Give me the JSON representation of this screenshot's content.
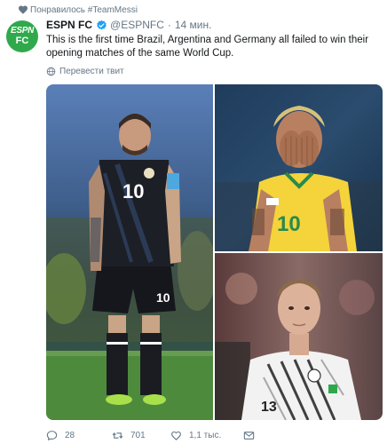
{
  "context": {
    "text": "Понравилось #TeamMessi"
  },
  "author": {
    "name": "ESPN FC",
    "handle": "@ESPNFC",
    "time": "14 мин.",
    "avatar_line1": "ESPN",
    "avatar_line2": "FC",
    "avatar_color": "#2fa94b",
    "verified": true
  },
  "tweet": {
    "text": "This is the first time Brazil, Argentina and Germany all failed to win their opening matches of the same World Cup.",
    "translate_label": "Перевести твит"
  },
  "media": {
    "photos": [
      {
        "name": "argentina-player",
        "jersey_number": "10"
      },
      {
        "name": "brazil-player",
        "jersey_number": "10"
      },
      {
        "name": "germany-player",
        "jersey_number": "13"
      }
    ]
  },
  "actions": {
    "reply_count": "28",
    "retweet_count": "701",
    "like_count": "1,1 тыс.",
    "icons": [
      "reply-icon",
      "retweet-icon",
      "like-icon",
      "direct-message-icon"
    ]
  },
  "colors": {
    "text_primary": "#14171a",
    "text_secondary": "#657786",
    "verified_blue": "#1da1f2",
    "espn_green": "#2fa94b"
  }
}
